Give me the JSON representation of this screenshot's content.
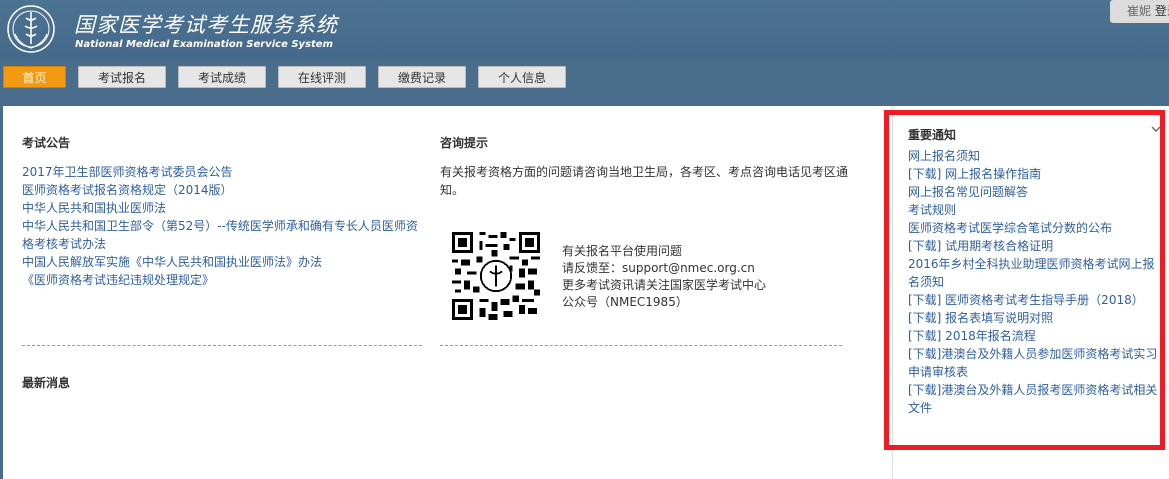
{
  "header": {
    "title": "国家医学考试考生服务系统",
    "subtitle": "National Medical Examination Service System",
    "user_name": "崔妮",
    "login_label": "登录"
  },
  "nav": {
    "items": [
      {
        "label": "首页",
        "active": true
      },
      {
        "label": "考试报名",
        "active": false
      },
      {
        "label": "考试成绩",
        "active": false
      },
      {
        "label": "在线评测",
        "active": false
      },
      {
        "label": "缴费记录",
        "active": false
      },
      {
        "label": "个人信息",
        "active": false
      }
    ]
  },
  "announcements": {
    "title": "考试公告",
    "items": [
      "2017年卫生部医师资格考试委员会公告",
      "医师资格考试报名资格规定（2014版）",
      "中华人民共和国执业医师法",
      "中华人民共和国卫生部令（第52号）--传统医学师承和确有专长人员医师资",
      "格考核考试办法",
      "中国人民解放军实施《中华人民共和国执业医师法》办法",
      "《医师资格考试违纪违规处理规定》"
    ]
  },
  "consult": {
    "title": "咨询提示",
    "text": "有关报考资格方面的问题请咨询当地卫生局，各考区、考点咨询电话见考区通知。",
    "contact_lines": [
      "有关报名平台使用问题",
      "请反馈至：support@nmec.org.cn",
      "更多考试资讯请关注国家医学考试中心",
      "公众号（NMEC1985）"
    ]
  },
  "news": {
    "title": "最新消息"
  },
  "notices": {
    "title": "重要通知",
    "items": [
      "网上报名须知",
      "[下载] 网上报名操作指南",
      "网上报名常见问题解答",
      "考试规则",
      "医师资格考试医学综合笔试分数的公布",
      "[下载] 试用期考核合格证明",
      "2016年乡村全科执业助理医师资格考试网上报名须知",
      "[下载] 医师资格考试考生指导手册（2018）",
      "[下载] 报名表填写说明对照",
      "[下载] 2018年报名流程",
      "[下载]港澳台及外籍人员参加医师资格考试实习申请审核表",
      "[下载]港澳台及外籍人员报考医师资格考试相关文件"
    ]
  },
  "colors": {
    "header_bg": "#4a6d8c",
    "nav_active": "#f39a12",
    "link": "#2f5fa0",
    "highlight": "#ee1c24"
  }
}
